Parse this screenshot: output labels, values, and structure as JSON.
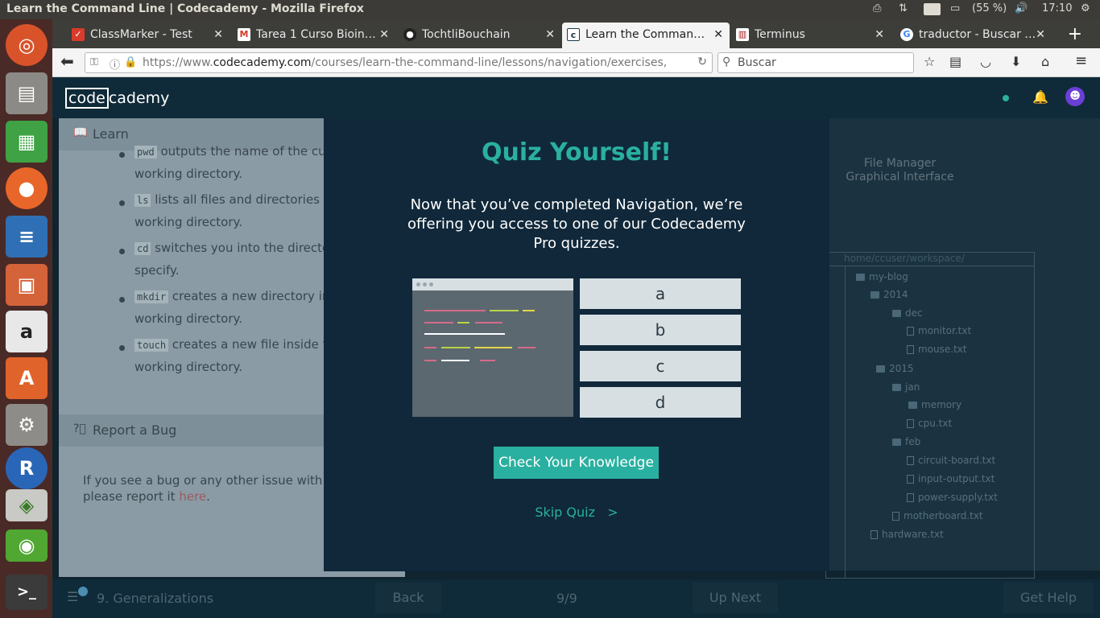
{
  "system": {
    "window_title": "Learn the Command Line | Codecademy - Mozilla Firefox",
    "keyboard_layout": "Es",
    "battery": "(55 %)",
    "clock": "17:10"
  },
  "tabs": [
    {
      "label": "ClassMarker - Test",
      "close": "✕"
    },
    {
      "label": "Tarea 1 Curso Bioin…",
      "close": "✕"
    },
    {
      "label": "TochtliBouchain",
      "close": "✕"
    },
    {
      "label": "Learn the Comman…",
      "close": "✕"
    },
    {
      "label": "Terminus",
      "close": "✕"
    },
    {
      "label": "traductor - Buscar …",
      "close": "✕"
    }
  ],
  "navbar": {
    "url_prefix": "https://www.",
    "url_domain": "codecademy.com",
    "url_rest": "/courses/learn-the-command-line/lessons/navigation/exercises,",
    "search_placeholder": "Buscar"
  },
  "site": {
    "logo_code": "code",
    "logo_rest": "cademy"
  },
  "learn_panel": {
    "header": "Learn",
    "items": [
      {
        "code": "pwd",
        "text": " outputs the name of the cur",
        "line2": "working directory."
      },
      {
        "code": "ls",
        "text": " lists all files and directories in",
        "line2": "working directory."
      },
      {
        "code": "cd",
        "text": " switches you into the director",
        "line2": "specify."
      },
      {
        "code": "mkdir",
        "text": " creates a new directory in",
        "line2": "working directory."
      },
      {
        "code": "touch",
        "text": " creates a new file inside th",
        "line2": "working directory."
      }
    ]
  },
  "bug_panel": {
    "header": "Report a Bug",
    "text": "If you see a bug or any other issue with this",
    "text2": "please report it ",
    "link": "here",
    "end": "."
  },
  "file_manager": {
    "title_line1": "File Manager",
    "title_line2": "Graphical Interface",
    "path": "home/ccuser/workspace/",
    "nodes": [
      {
        "name": "my-blog",
        "type": "folder"
      },
      {
        "name": "2014",
        "type": "folder"
      },
      {
        "name": "dec",
        "type": "folder"
      },
      {
        "name": "monitor.txt",
        "type": "file"
      },
      {
        "name": "mouse.txt",
        "type": "file"
      },
      {
        "name": "2015",
        "type": "folder"
      },
      {
        "name": "jan",
        "type": "folder"
      },
      {
        "name": "memory",
        "type": "folder"
      },
      {
        "name": "cpu.txt",
        "type": "file"
      },
      {
        "name": "feb",
        "type": "folder"
      },
      {
        "name": "circuit-board.txt",
        "type": "file"
      },
      {
        "name": "input-output.txt",
        "type": "file"
      },
      {
        "name": "power-supply.txt",
        "type": "file"
      },
      {
        "name": "motherboard.txt",
        "type": "file"
      },
      {
        "name": "hardware.txt",
        "type": "file"
      }
    ]
  },
  "footer": {
    "lesson": "9. Generalizations",
    "back": "Back",
    "progress": "9/9",
    "up_next": "Up Next",
    "get_help": "Get Help"
  },
  "modal": {
    "title": "Quiz Yourself!",
    "text": "Now that you’ve completed Navigation, we’re offering you access to one of our Codecademy Pro quizzes.",
    "options": [
      "a",
      "b",
      "c",
      "d"
    ],
    "check_button": "Check Your Knowledge",
    "skip": "Skip Quiz   >"
  },
  "colors": {
    "accent": "#2ab0a0",
    "modal_bg": "#10283a",
    "header_bg": "#0f2a38"
  }
}
